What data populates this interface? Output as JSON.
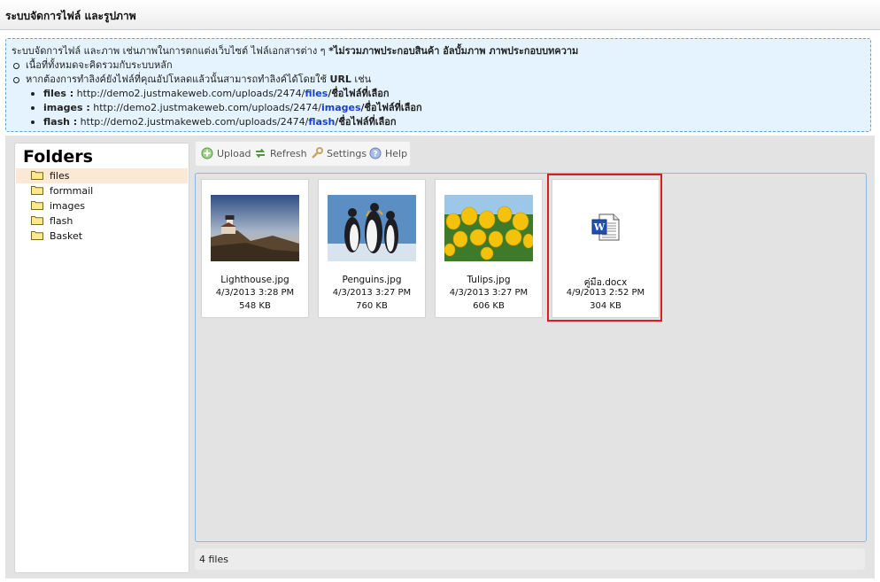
{
  "header": {
    "title": "ระบบจัดการไฟล์ และรูปภาพ"
  },
  "info": {
    "intro_plain": "ระบบจัดการไฟล์ และภาพ เช่นภาพในการตกแต่งเว็บไซต์ ไฟล์เอกสารต่าง ๆ ",
    "intro_bold": "*ไม่รวมภาพประกอบสินค้า อัลบั้มภาพ ภาพประกอบบทความ",
    "bullet1": "เนื้อที่ทั้งหมดจะคิดรวมกับระบบหลัก",
    "bullet2_plain": "หากต้องการทำลิงค์ยังไฟล์ที่คุณอัปโหลดแล้วนั้นสามารถทำลิงค์ได้โดยใช้ ",
    "bullet2_bold": "URL",
    "bullet2_end": " เช่น",
    "examples": [
      {
        "label": "files :",
        "prefix": " http://demo2.justmakeweb.com/uploads/2474/",
        "folder": "files",
        "suffix": "/ชื่อไฟล์ที่เลือก"
      },
      {
        "label": "images :",
        "prefix": " http://demo2.justmakeweb.com/uploads/2474/",
        "folder": "images",
        "suffix": "/ชื่อไฟล์ที่เลือก"
      },
      {
        "label": "flash :",
        "prefix": " http://demo2.justmakeweb.com/uploads/2474/",
        "folder": "flash",
        "suffix": "/ชื่อไฟล์ที่เลือก"
      }
    ]
  },
  "sidebar": {
    "heading": "Folders",
    "folders": [
      {
        "name": "files",
        "selected": true
      },
      {
        "name": "formmail",
        "selected": false
      },
      {
        "name": "images",
        "selected": false
      },
      {
        "name": "flash",
        "selected": false
      },
      {
        "name": "Basket",
        "selected": false
      }
    ]
  },
  "toolbar": {
    "upload": "Upload",
    "refresh": "Refresh",
    "settings": "Settings",
    "help": "Help"
  },
  "files": [
    {
      "name": "Lighthouse.jpg",
      "date": "4/3/2013 3:28 PM",
      "size": "548 KB",
      "thumb": "lighthouse-photo"
    },
    {
      "name": "Penguins.jpg",
      "date": "4/3/2013 3:27 PM",
      "size": "760 KB",
      "thumb": "penguins-photo"
    },
    {
      "name": "Tulips.jpg",
      "date": "4/3/2013 3:27 PM",
      "size": "606 KB",
      "thumb": "tulips-photo"
    },
    {
      "name": "คู่มือ.docx",
      "date": "4/9/2013 2:52 PM",
      "size": "304 KB",
      "thumb": "word-document-icon"
    }
  ],
  "status": {
    "count_text": "4 files"
  },
  "colors": {
    "highlight": "#e01b1b",
    "link_folder": "#1a3fd1",
    "info_bg": "#e4f3fd",
    "selected_folder_bg": "#fbe8d5"
  }
}
